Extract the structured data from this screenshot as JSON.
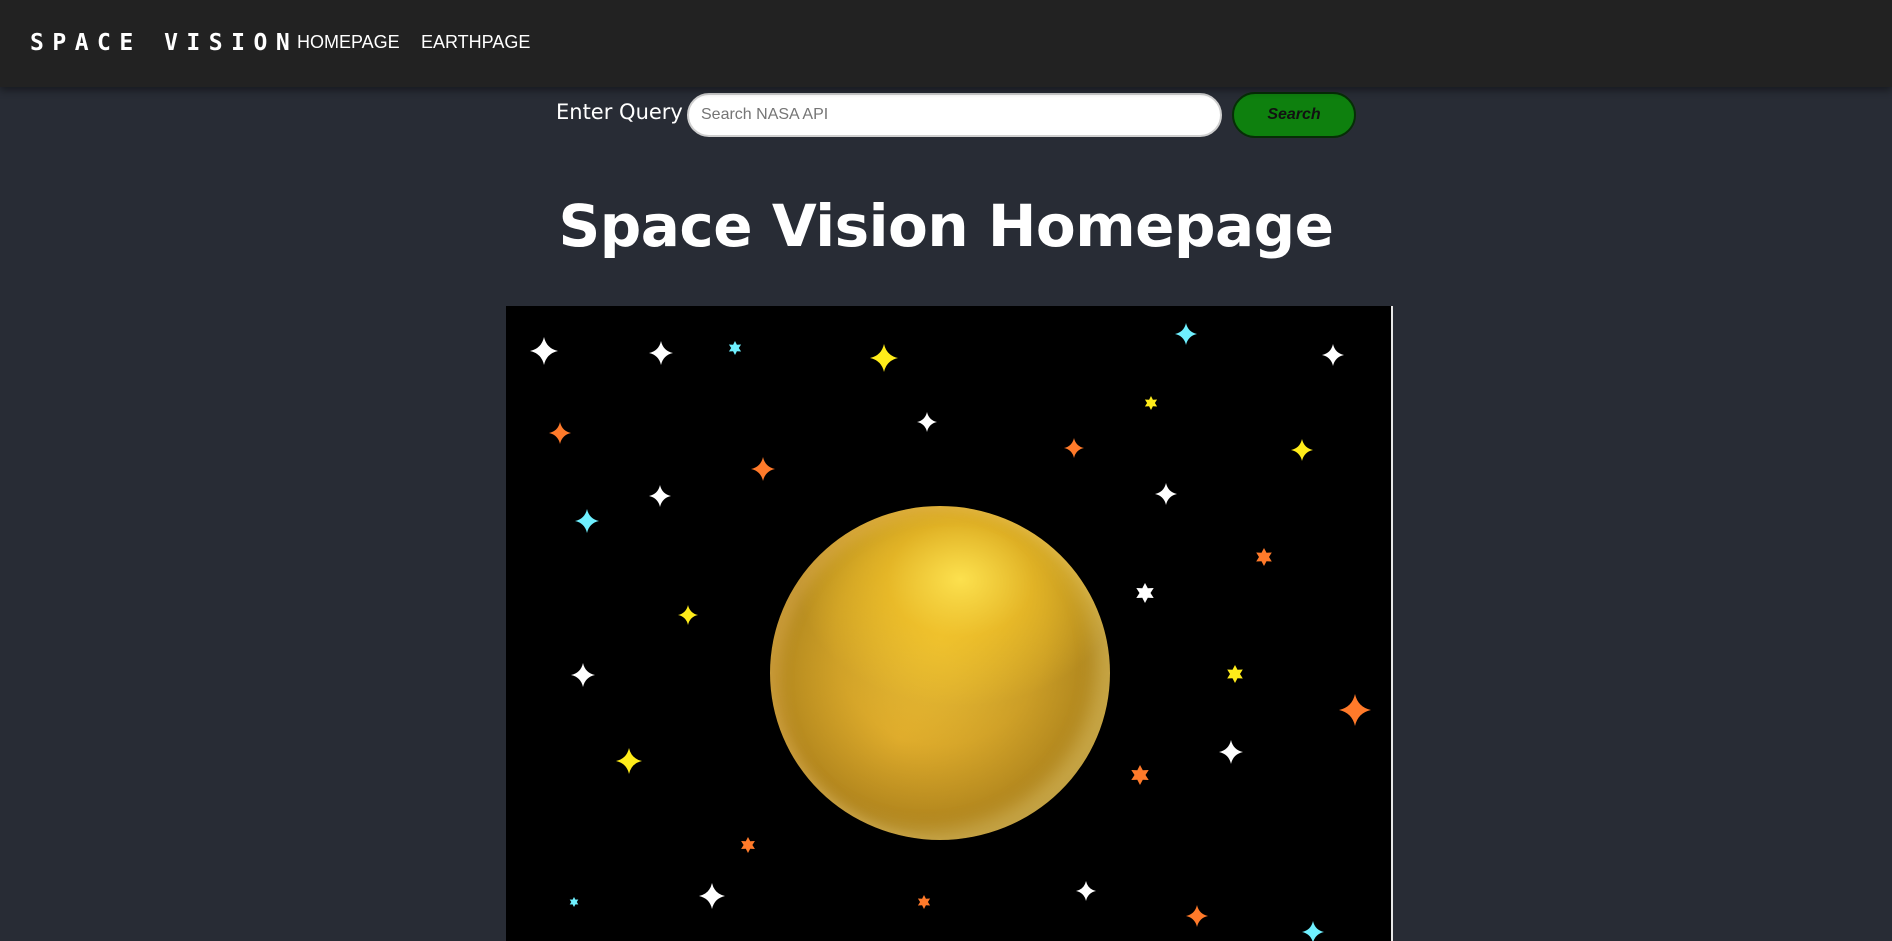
{
  "navbar": {
    "brand": "SPACE VISION",
    "links": [
      {
        "label": "HOMEPAGE"
      },
      {
        "label": "EARTHPAGE"
      }
    ]
  },
  "search": {
    "label": "Enter Query",
    "placeholder": "Search NASA API",
    "button_label": "Search"
  },
  "page": {
    "title": "Space Vision Homepage"
  },
  "scene": {
    "background": "#000000",
    "planet_color": "#e0ad2c",
    "star_colors": [
      "#ffffff",
      "#ffec1a",
      "#ff7a2a",
      "#6ff0ff"
    ]
  }
}
